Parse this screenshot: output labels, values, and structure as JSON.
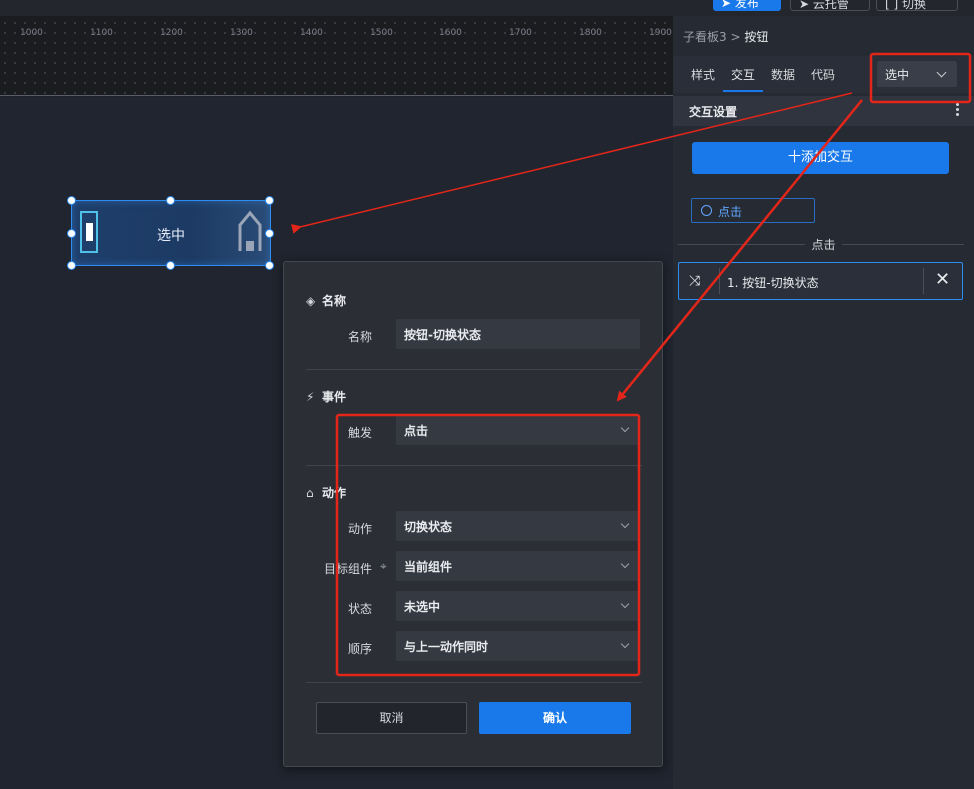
{
  "topbar": {
    "publish_label": "发布",
    "cloud_label": "云托管",
    "switch_label": "切换"
  },
  "ruler": {
    "ticks": [
      "1000",
      "1100",
      "1200",
      "1300",
      "1400",
      "1500",
      "1600",
      "1700",
      "1800",
      "1900"
    ]
  },
  "component": {
    "label": "选中"
  },
  "panel": {
    "breadcrumb_parent": "子看板3",
    "breadcrumb_sep": ">",
    "breadcrumb_current": "按钮",
    "tabs": [
      {
        "label": "样式"
      },
      {
        "label": "交互"
      },
      {
        "label": "数据"
      },
      {
        "label": "代码"
      }
    ],
    "active_tab": "交互",
    "state_select": "选中",
    "section_title": "交互设置",
    "add_button": "十添加交互",
    "trigger_chip": "点击",
    "divider_label": "点击",
    "action_item": "1. 按钮-切换状态"
  },
  "dialog": {
    "section_name": "名称",
    "name_label": "名称",
    "name_value": "按钮-切换状态",
    "section_event": "事件",
    "trigger_label": "触发",
    "trigger_value": "点击",
    "section_action": "动作",
    "action_label": "动作",
    "action_value": "切换状态",
    "target_label": "目标组件",
    "target_value": "当前组件",
    "state_label": "状态",
    "state_value": "未选中",
    "order_label": "顺序",
    "order_value": "与上一动作同时",
    "cancel": "取消",
    "confirm": "确认"
  },
  "colors": {
    "accent": "#1a79ea",
    "annotation": "#e32619"
  }
}
